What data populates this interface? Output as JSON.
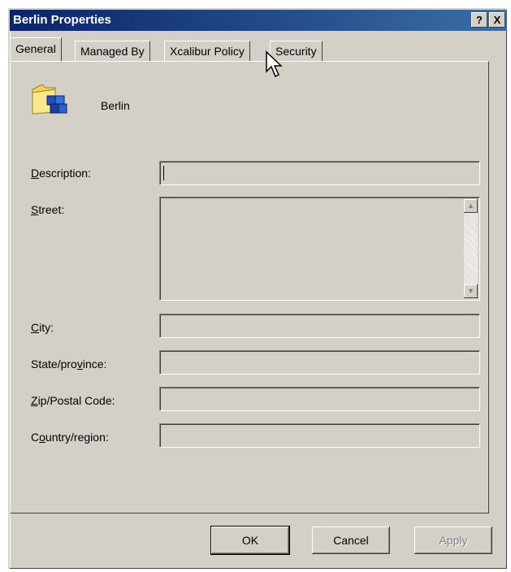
{
  "window": {
    "title": "Berlin Properties",
    "help_button": "?",
    "close_button": "X"
  },
  "tabs": [
    {
      "label": "General",
      "active": true
    },
    {
      "label": "Managed By",
      "active": false
    },
    {
      "label": "Xcalibur Policy",
      "active": false
    },
    {
      "label": "Security",
      "active": false
    }
  ],
  "object": {
    "icon": "ou-folder-icon",
    "name": "Berlin"
  },
  "form": {
    "description": {
      "label_pre": "",
      "label_key": "D",
      "label_post": "escription:",
      "value": ""
    },
    "street": {
      "label_pre": "",
      "label_key": "S",
      "label_post": "treet:",
      "value": ""
    },
    "city": {
      "label_pre": "",
      "label_key": "C",
      "label_post": "ity:",
      "value": ""
    },
    "state": {
      "label_pre": "State/pro",
      "label_key": "v",
      "label_post": "ince:",
      "value": ""
    },
    "zip": {
      "label_pre": "",
      "label_key": "Z",
      "label_post": "ip/Postal Code:",
      "value": ""
    },
    "country": {
      "label_pre": "C",
      "label_key": "o",
      "label_post": "untry/region:",
      "value": ""
    }
  },
  "buttons": {
    "ok": "OK",
    "cancel": "Cancel",
    "apply": "Apply"
  }
}
